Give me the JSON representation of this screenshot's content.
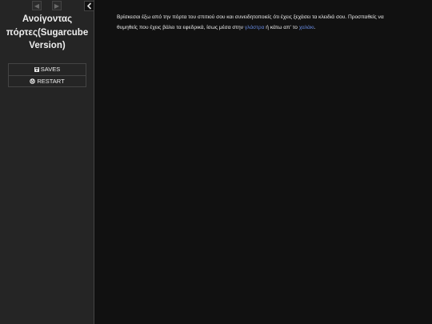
{
  "sidebar": {
    "history_back_icon": "arrow-left-icon",
    "history_forward_icon": "arrow-right-icon",
    "stow_icon": "chevron-left-icon",
    "title_line1": "Ανοίγοντας",
    "title_line2": "πόρτες(Sugarcube",
    "title_line3": "Version)",
    "menu": {
      "saves_label": "SAVES",
      "saves_icon": "save-icon",
      "restart_label": "RESTART",
      "restart_icon": "power-icon"
    }
  },
  "passage": {
    "text_part1": "Βρίσκεσαι έξω από την πόρτα του σπιτιού σου και συνειδητοποιείς ότι έχεις ξεχάσει τα κλειδιά σου. Προσπαθείς να θυμηθείς που έχεις βάλει τα εφεδρικά, ίσως μέσα στην ",
    "link1": "γλάστρα",
    "text_part2": " ή κάτω απ' το ",
    "link2": "χαλάκι",
    "text_part3": "."
  },
  "colors": {
    "sidebar_bg": "#252525",
    "main_bg": "#111111",
    "link": "#6688dd",
    "text": "#eeeeee"
  }
}
